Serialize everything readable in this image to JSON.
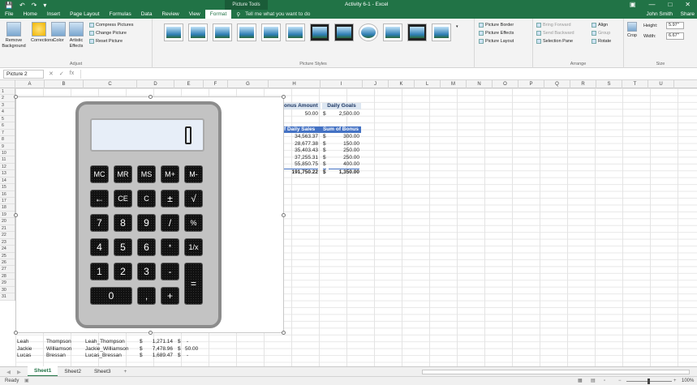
{
  "titlebar": {
    "context_title": "Picture Tools",
    "doc_title": "Activity 6-1 - Excel",
    "save_icon": "save-icon",
    "undo_icon": "undo-icon",
    "redo_icon": "redo-icon",
    "qat_icon": "customize-qat-icon"
  },
  "tabs": [
    "File",
    "Home",
    "Insert",
    "Page Layout",
    "Formulas",
    "Data",
    "Review",
    "View",
    "Format"
  ],
  "tellme": "Tell me what you want to do",
  "user": "John Smith",
  "share": "Share",
  "ribbon": {
    "adjust": {
      "remove_bg": "Remove Background",
      "corrections": "Corrections",
      "color": "Color",
      "artistic": "Artistic Effects",
      "compress": "Compress Pictures",
      "change": "Change Picture",
      "reset": "Reset Picture",
      "label": "Adjust"
    },
    "styles": {
      "label": "Picture Styles",
      "border": "Picture Border",
      "effects": "Picture Effects",
      "layout": "Picture Layout"
    },
    "arrange": {
      "forward": "Bring Forward",
      "backward": "Send Backward",
      "pane": "Selection Pane",
      "align": "Align",
      "group": "Group",
      "rotate": "Rotate",
      "label": "Arrange"
    },
    "size": {
      "crop": "Crop",
      "height_label": "Height:",
      "height": "5.97\"",
      "width_label": "Width:",
      "width": "6.67\"",
      "label": "Size"
    }
  },
  "formula": {
    "namebox": "Picture 2",
    "fx": "fx"
  },
  "columns": [
    "A",
    "B",
    "C",
    "D",
    "E",
    "F",
    "G",
    "H",
    "I",
    "J",
    "K",
    "L",
    "M",
    "N",
    "O",
    "P",
    "Q",
    "R",
    "S",
    "T",
    "U"
  ],
  "rows": [
    "1",
    "2",
    "3",
    "4",
    "5",
    "6",
    "7",
    "8",
    "9",
    "10",
    "11",
    "12",
    "13",
    "14",
    "15",
    "16",
    "17",
    "18",
    "19",
    "20",
    "21",
    "22",
    "23",
    "24",
    "25",
    "26",
    "27",
    "28",
    "29",
    "30",
    "31"
  ],
  "table1": {
    "h1": "onus Amount",
    "h2": "Daily Goals",
    "v1": "50.00",
    "c1": "$",
    "v2": "2,500.00"
  },
  "table2": {
    "h1": "f Daily Sales",
    "h2": "Sum of Bonus",
    "rows": [
      [
        "34,563.37",
        "$",
        "300.00"
      ],
      [
        "28,677.38",
        "$",
        "150.00"
      ],
      [
        "35,403.43",
        "$",
        "250.00"
      ],
      [
        "37,255.31",
        "$",
        "250.00"
      ],
      [
        "55,850.75",
        "$",
        "400.00"
      ]
    ],
    "total": [
      "191,750.22",
      "$",
      "1,350.00"
    ]
  },
  "data_rows": [
    {
      "row": "29",
      "a": "Leah",
      "b": "Thompson",
      "c": "Leah_Thompson",
      "d1": "$",
      "d2": "1,271.14",
      "e1": "$",
      "e2": "-"
    },
    {
      "row": "30",
      "a": "Jackie",
      "b": "Williamson",
      "c": "Jackie_Williamson",
      "d1": "$",
      "d2": "7,478.96",
      "e1": "$",
      "e2": "50.00"
    },
    {
      "row": "31",
      "a": "Lucas",
      "b": "Bressan",
      "c": "Lucas_Bressan",
      "d1": "$",
      "d2": "1,689.47",
      "e1": "$",
      "e2": "-"
    }
  ],
  "calculator": {
    "display": "0",
    "keys": [
      [
        "MC",
        "MR",
        "MS",
        "M+",
        "M-"
      ],
      [
        "←",
        "CE",
        "C",
        "±",
        "√"
      ],
      [
        "7",
        "8",
        "9",
        "/",
        "%"
      ],
      [
        "4",
        "5",
        "6",
        "*",
        "1/x"
      ],
      [
        "1",
        "2",
        "3",
        "-",
        "="
      ],
      [
        "0",
        ",",
        "+"
      ]
    ]
  },
  "sheets": [
    "Sheet1",
    "Sheet2",
    "Sheet3"
  ],
  "add_sheet": "+",
  "status": {
    "ready": "Ready",
    "zoom": "100%"
  }
}
